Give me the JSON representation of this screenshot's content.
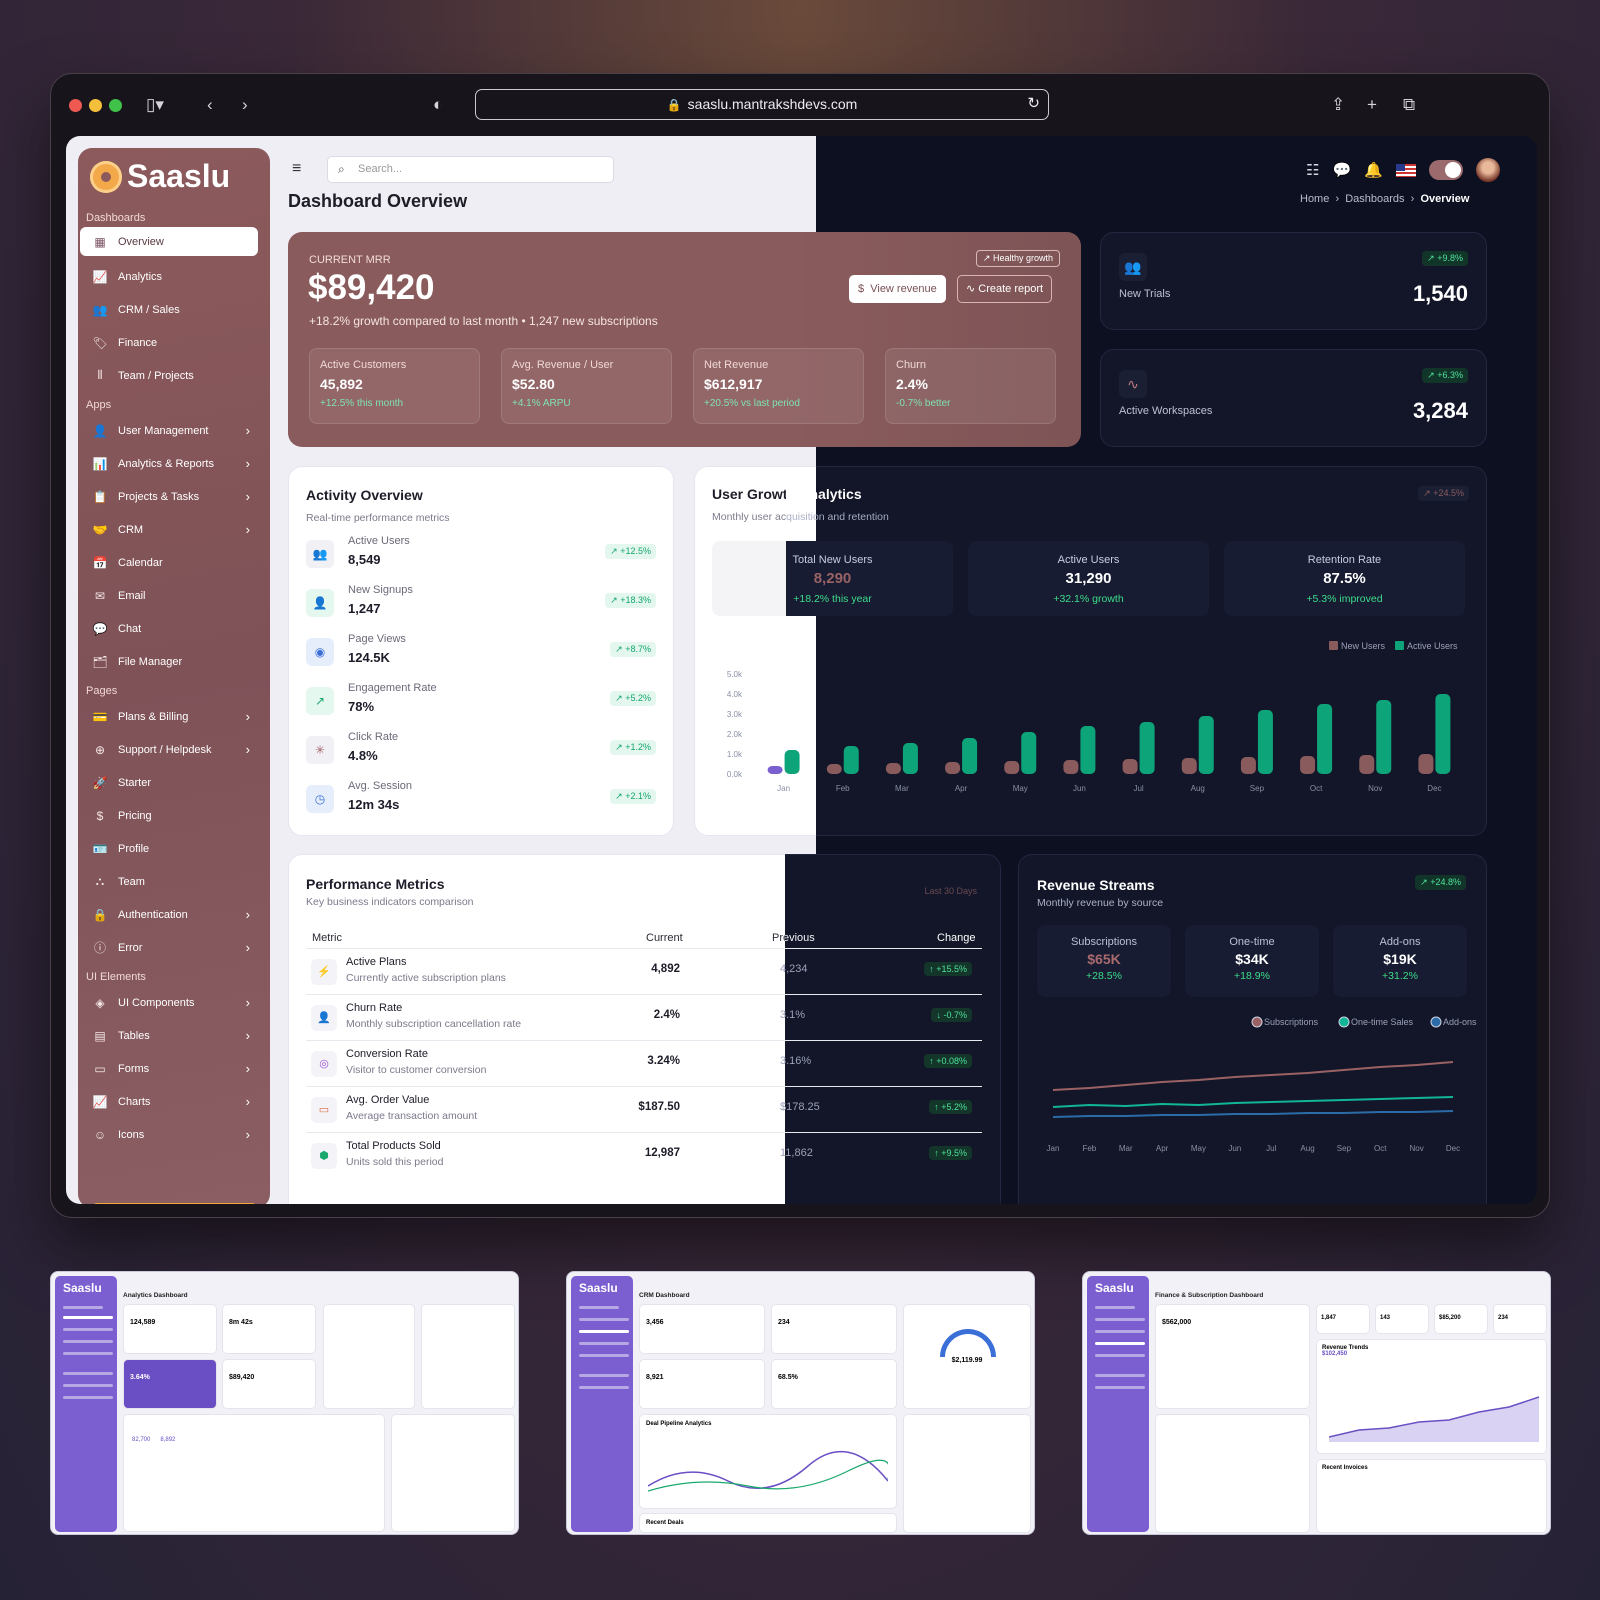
{
  "browser": {
    "url": "saaslu.mantrakshdevs.com"
  },
  "app": {
    "brand": "Saaslu",
    "search_placeholder": "Search...",
    "page_title": "Dashboard Overview"
  },
  "sidebar": {
    "section_dashboards": "Dashboards",
    "overview": "Overview",
    "analytics": "Analytics",
    "crm_sales": "CRM / Sales",
    "finance": "Finance",
    "team_projects": "Team / Projects",
    "section_apps": "Apps",
    "user_management": "User Management",
    "analytics_reports": "Analytics & Reports",
    "projects_tasks": "Projects & Tasks",
    "crm": "CRM",
    "calendar": "Calendar",
    "email": "Email",
    "chat": "Chat",
    "file_manager": "File Manager",
    "section_pages": "Pages",
    "plans_billing": "Plans & Billing",
    "support": "Support / Helpdesk",
    "starter": "Starter",
    "pricing": "Pricing",
    "profile": "Profile",
    "team": "Team",
    "authentication": "Authentication",
    "error": "Error",
    "section_ui": "UI Elements",
    "ui_components": "UI Components",
    "tables": "Tables",
    "forms": "Forms",
    "charts": "Charts",
    "icons": "Icons"
  },
  "breadcrumb": {
    "home": "Home",
    "dashboards": "Dashboards",
    "current": "Overview"
  },
  "hero": {
    "label": "CURRENT MRR",
    "value": "$89,420",
    "subtitle": "+18.2% growth compared to last month • 1,247 new subscriptions",
    "badge": "Healthy growth",
    "view_revenue": "View revenue",
    "create_report": "Create report",
    "metrics": [
      {
        "label": "Active Customers",
        "value": "45,892",
        "delta": "+12.5% this month"
      },
      {
        "label": "Avg. Revenue / User",
        "value": "$52.80",
        "delta": "+4.1% ARPU"
      },
      {
        "label": "Net Revenue",
        "value": "$612,917",
        "delta": "+20.5% vs last period"
      },
      {
        "label": "Churn",
        "value": "2.4%",
        "delta": "-0.7% better"
      }
    ]
  },
  "stats": [
    {
      "label": "New Trials",
      "value": "1,540",
      "badge": "+9.8%"
    },
    {
      "label": "Active Workspaces",
      "value": "3,284",
      "badge": "+6.3%"
    }
  ],
  "activity": {
    "title": "Activity Overview",
    "subtitle": "Real-time performance metrics",
    "items": [
      {
        "label": "Active Users",
        "value": "8,549",
        "badge": "+12.5%"
      },
      {
        "label": "New Signups",
        "value": "1,247",
        "badge": "+18.3%"
      },
      {
        "label": "Page Views",
        "value": "124.5K",
        "badge": "+8.7%"
      },
      {
        "label": "Engagement Rate",
        "value": "78%",
        "badge": "+5.2%"
      },
      {
        "label": "Click Rate",
        "value": "4.8%",
        "badge": "+1.2%"
      },
      {
        "label": "Avg. Session",
        "value": "12m 34s",
        "badge": "+2.1%"
      }
    ]
  },
  "growth": {
    "title": "User Growth Analytics",
    "subtitle": "Monthly user acquisition and retention",
    "badge": "+24.5%",
    "boxes": [
      {
        "label": "Total New Users",
        "value": "8,290",
        "delta": "+18.2% this year"
      },
      {
        "label": "Active Users",
        "value": "31,290",
        "delta": "+32.1% growth"
      },
      {
        "label": "Retention Rate",
        "value": "87.5%",
        "delta": "+5.3% improved"
      }
    ]
  },
  "chart_data": [
    {
      "type": "bar",
      "categories": [
        "Jan",
        "Feb",
        "Mar",
        "Apr",
        "May",
        "Jun",
        "Jul",
        "Aug",
        "Sep",
        "Oct",
        "Nov",
        "Dec"
      ],
      "ylim": [
        0,
        5000
      ],
      "yticks": [
        "0.0k",
        "1.0k",
        "2.0k",
        "3.0k",
        "4.0k",
        "5.0k"
      ],
      "series": [
        {
          "name": "New Users",
          "color": "#8a5b5c",
          "values": [
            400,
            500,
            550,
            600,
            650,
            700,
            750,
            800,
            850,
            900,
            950,
            1000
          ]
        },
        {
          "name": "Active Users",
          "color": "#0ea47a",
          "values": [
            1200,
            1400,
            1550,
            1800,
            2100,
            2400,
            2600,
            2900,
            3200,
            3500,
            3700,
            4000
          ]
        }
      ]
    },
    {
      "type": "line",
      "categories": [
        "Jan",
        "Feb",
        "Mar",
        "Apr",
        "May",
        "Jun",
        "Jul",
        "Aug",
        "Sep",
        "Oct",
        "Nov",
        "Dec"
      ],
      "series": [
        {
          "name": "Subscriptions",
          "color": "#9a6264",
          "values": [
            45,
            47,
            50,
            53,
            55,
            58,
            60,
            62,
            65,
            68,
            70,
            73
          ]
        },
        {
          "name": "One-time Sales",
          "color": "#11b597",
          "values": [
            28,
            30,
            29,
            31,
            30,
            32,
            33,
            34,
            35,
            36,
            37,
            38
          ]
        },
        {
          "name": "Add-ons",
          "color": "#2b6ca8",
          "values": [
            18,
            19,
            19,
            20,
            20,
            21,
            21,
            22,
            22,
            23,
            23,
            24
          ]
        }
      ]
    }
  ],
  "performance": {
    "title": "Performance Metrics",
    "subtitle": "Key business indicators comparison",
    "period": "Last 30 Days",
    "headers": {
      "metric": "Metric",
      "current": "Current",
      "previous": "Previous",
      "change": "Change"
    },
    "rows": [
      {
        "name": "Active Plans",
        "desc": "Currently active subscription plans",
        "current": "4,892",
        "previous": "4,234",
        "change": "↑ +15.5%"
      },
      {
        "name": "Churn Rate",
        "desc": "Monthly subscription cancellation rate",
        "current": "2.4%",
        "previous": "3.1%",
        "change": "↓ -0.7%"
      },
      {
        "name": "Conversion Rate",
        "desc": "Visitor to customer conversion",
        "current": "3.24%",
        "previous": "3.16%",
        "change": "↑ +0.08%"
      },
      {
        "name": "Avg. Order Value",
        "desc": "Average transaction amount",
        "current": "$187.50",
        "previous": "$178.25",
        "change": "↑ +5.2%"
      },
      {
        "name": "Total Products Sold",
        "desc": "Units sold this period",
        "current": "12,987",
        "previous": "11,862",
        "change": "↑ +9.5%"
      }
    ]
  },
  "revenue": {
    "title": "Revenue Streams",
    "subtitle": "Monthly revenue by source",
    "badge": "+24.8%",
    "boxes": [
      {
        "label": "Subscriptions",
        "value": "$65K",
        "delta": "+28.5%"
      },
      {
        "label": "One-time",
        "value": "$34K",
        "delta": "+18.9%"
      },
      {
        "label": "Add-ons",
        "value": "$19K",
        "delta": "+31.2%"
      }
    ],
    "legend": [
      "Subscriptions",
      "One-time Sales",
      "Add-ons"
    ]
  },
  "thumbnails": [
    {
      "brand": "Saaslu",
      "title": "Analytics Dashboard",
      "v1": "124,589",
      "v2": "8m 42s",
      "v3": "3.64%",
      "v4": "$89,420",
      "v5": "82,700",
      "v6": "8,892"
    },
    {
      "brand": "Saaslu",
      "title": "CRM Dashboard",
      "v1": "3,456",
      "v2": "234",
      "v3": "8,921",
      "v4": "68.5%",
      "gauge": "$2,119.99",
      "s1": "Deal Pipeline Analytics",
      "s2": "Recent Deals"
    },
    {
      "brand": "Saaslu",
      "title": "Finance & Subscription Dashboard",
      "v1": "$562,000",
      "v2": "1,847",
      "v3": "143",
      "v4": "$85,200",
      "v5": "234",
      "s1": "Revenue Trends",
      "s2": "Recent Invoices",
      "s3": "$102,450"
    }
  ]
}
